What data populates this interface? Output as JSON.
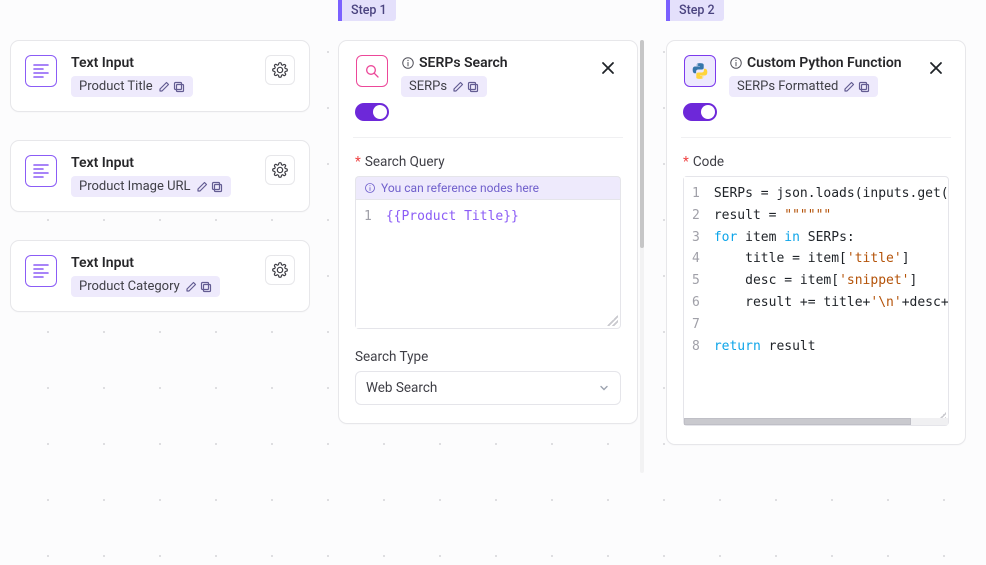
{
  "inputs": [
    {
      "title": "Text Input",
      "chip": "Product Title"
    },
    {
      "title": "Text Input",
      "chip": "Product Image URL"
    },
    {
      "title": "Text Input",
      "chip": "Product Category"
    }
  ],
  "step1": {
    "tag": "Step 1",
    "title": "SERPs Search",
    "chip": "SERPs",
    "query": {
      "label": "Search Query",
      "hint": "You can reference nodes here",
      "line1": "{{Product Title}}"
    },
    "searchType": {
      "label": "Search Type",
      "value": "Web Search"
    }
  },
  "step2": {
    "tag": "Step 2",
    "title": "Custom Python Function",
    "chip": "SERPs Formatted",
    "code": {
      "label": "Code",
      "lines": [
        {
          "pre": "SERPs = json.loads(inputs.get("
        },
        {
          "pre": "result = ",
          "str": "\"\"\"\"\"\""
        },
        {
          "kw": "for",
          "mid1": " item ",
          "kw2": "in",
          "mid2": " SERPs:"
        },
        {
          "indent": "    title = item[",
          "str": "'title'",
          "post": "]"
        },
        {
          "indent": "    desc = item[",
          "str": "'snippet'",
          "post": "]"
        },
        {
          "indent": "    result += title+",
          "str": "'\\n'",
          "post": "+desc+"
        },
        {
          "blank": " "
        },
        {
          "kw": "return",
          "mid1": " result"
        }
      ]
    }
  }
}
